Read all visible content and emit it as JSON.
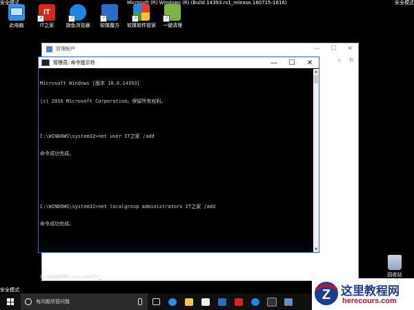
{
  "screen": {
    "safe_mode_label": "安全模式",
    "build_info": "Microsoft (R) Windows (R) (Build 14393.rs1_release.160715-1616)"
  },
  "desktop_icons": [
    {
      "label": "此电脑",
      "color": "#3b8ede"
    },
    {
      "label": "IT之家",
      "color": "#d9261c"
    },
    {
      "label": "旗鱼浏览器",
      "color": "#1e88e5"
    },
    {
      "label": "软媒魔方",
      "color": "#2b6cc4"
    },
    {
      "label": "软媒软件管家",
      "color": "#e53935"
    },
    {
      "label": "一键清理",
      "color": "#7cb342"
    }
  ],
  "background_window": {
    "title": "管理帐户",
    "minimize": "—",
    "maximize": "☐",
    "close": "✕"
  },
  "cmd_window": {
    "title": "管理员: 命令提示符",
    "minimize": "—",
    "maximize": "☐",
    "close": "✕",
    "lines": [
      "Microsoft Windows [版本 10.0.14393]",
      "(c) 2016 Microsoft Corporation。保留所有权利。",
      "",
      "C:\\WINDOWS\\system32>net user IT之家 /add",
      "命令成功完成。",
      "",
      "",
      "C:\\WINDOWS\\system32>net localgroup administrators IT之家 /add",
      "命令成功完成。",
      "",
      "",
      "C:\\WINDOWS\\system32>"
    ]
  },
  "recycle_bin": {
    "label": "回收站"
  },
  "taskbar": {
    "search_placeholder": "有问题尽管问我",
    "icons": [
      "task-view-icon",
      "edge-icon",
      "file-explorer-icon",
      "store-icon",
      "rubik-cube-icon",
      "ithome-icon",
      "browser-icon",
      "cmd-icon",
      "user-icon"
    ]
  },
  "watermark": {
    "title": "这里教程网",
    "url": "herecours.com"
  },
  "colors": {
    "cmd_border": "#2d6fd1",
    "watermark_title": "#1a3f8f",
    "watermark_url": "#c8102e"
  }
}
